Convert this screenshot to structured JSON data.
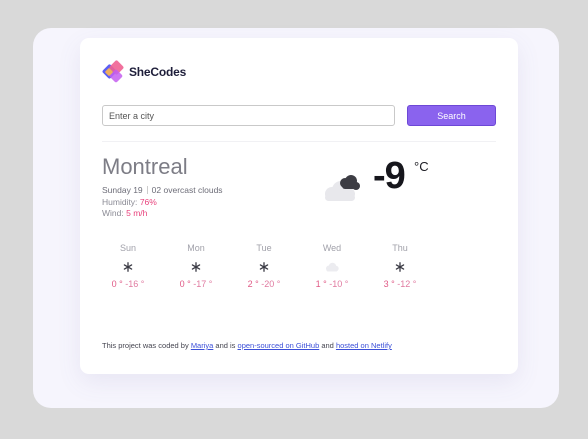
{
  "brand": {
    "name": "SheCodes",
    "colors": [
      "#5b5ff4",
      "#f06292",
      "#c45ef0",
      "#ffb74d"
    ]
  },
  "search": {
    "placeholder": "Enter a city",
    "button_label": "Search"
  },
  "current": {
    "city": "Montreal",
    "day_time": "Sunday 19",
    "time": "02",
    "description": "overcast clouds",
    "humidity_label": "Humidity:",
    "humidity_value": "76%",
    "wind_label": "Wind:",
    "wind_value": "5 m/h",
    "temperature": "-9",
    "unit": "°C",
    "icon": "cloudy-icon"
  },
  "forecast": [
    {
      "day": "Sun",
      "icon": "snowflake-icon",
      "max": "0 °",
      "min": "-16 °"
    },
    {
      "day": "Mon",
      "icon": "snowflake-icon",
      "max": "0 °",
      "min": "-17 °"
    },
    {
      "day": "Tue",
      "icon": "snowflake-icon",
      "max": "2 °",
      "min": "-20 °"
    },
    {
      "day": "Wed",
      "icon": "cloud-icon",
      "max": "1 °",
      "min": "-10 °"
    },
    {
      "day": "Thu",
      "icon": "snowflake-icon",
      "max": "3 °",
      "min": "-12 °"
    }
  ],
  "footer": {
    "text_1": "This project was coded by",
    "author": "Mariya",
    "text_2": "and is",
    "repo_link": "open-sourced on GitHub",
    "text_3": "and",
    "host_link": "hosted on Netlify"
  },
  "colors": {
    "accent": "#8a63ee",
    "highlight": "#e8427c",
    "background": "#d9d9d9",
    "panel": "#f6f5fd"
  }
}
